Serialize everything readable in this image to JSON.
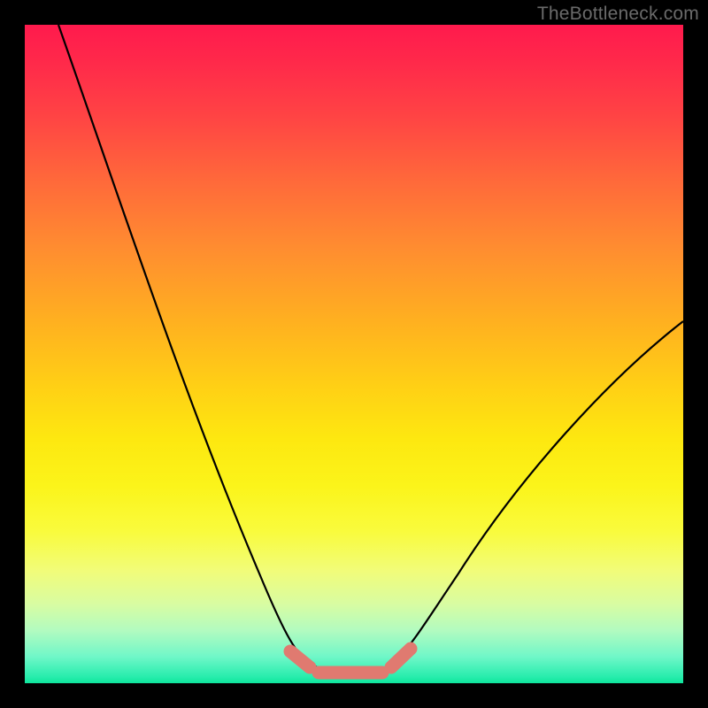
{
  "watermark": "TheBottleneck.com",
  "colors": {
    "background": "#000000",
    "curve": "#000000",
    "marker": "#e07a70",
    "gradient_top": "#ff1a4d",
    "gradient_mid": "#ffd015",
    "gradient_bottom": "#0ee69c"
  },
  "chart_data": {
    "type": "line",
    "title": "",
    "xlabel": "",
    "ylabel": "",
    "xlim": [
      0,
      100
    ],
    "ylim": [
      0,
      100
    ],
    "grid": false,
    "legend": false,
    "series": [
      {
        "name": "bottleneck-curve",
        "x": [
          5,
          10,
          15,
          20,
          25,
          30,
          35,
          38,
          41,
          44,
          47,
          50,
          53,
          56,
          60,
          65,
          70,
          75,
          80,
          85,
          90,
          95,
          100
        ],
        "y": [
          100,
          88,
          76,
          64,
          52,
          40,
          28,
          20,
          12,
          5,
          2,
          1,
          1,
          2,
          5,
          10,
          17,
          24,
          31,
          38,
          44,
          50,
          55
        ]
      }
    ],
    "markers": [
      {
        "name": "min-zone-left",
        "x_range": [
          42,
          45
        ],
        "y": 3
      },
      {
        "name": "min-zone-mid",
        "x_range": [
          46,
          54
        ],
        "y": 1
      },
      {
        "name": "min-zone-right",
        "x_range": [
          55,
          58
        ],
        "y": 3
      }
    ]
  }
}
